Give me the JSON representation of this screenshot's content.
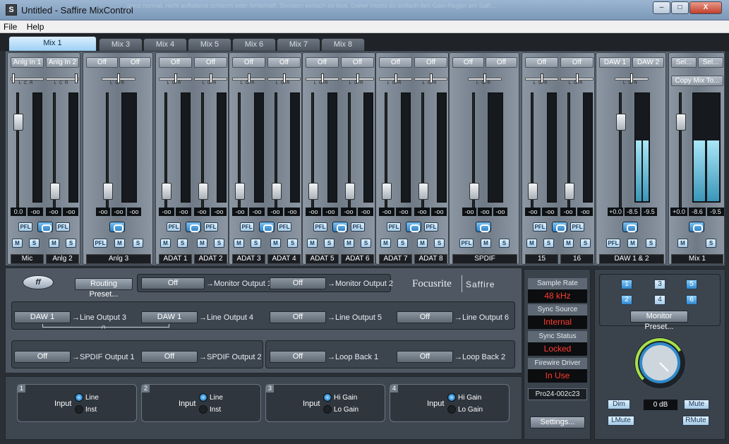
{
  "window": {
    "title": "Untitled - Saffire MixControl",
    "minimize": "–",
    "maximize": "□",
    "close": "X"
  },
  "menu": {
    "file": "File",
    "help": "Help"
  },
  "tabs": [
    "Mix 1",
    "Mix 3",
    "Mix 4",
    "Mix 5",
    "Mix 6",
    "Mix 7",
    "Mix 8"
  ],
  "strips": [
    {
      "left": "Anlg In 1",
      "right": "Anlg In 2",
      "read": [
        "0.0",
        "-oo",
        "-oo",
        "-oo"
      ],
      "name1": "Mic",
      "name2": "Anlg 2"
    },
    {
      "left": "Off",
      "right": "Off",
      "read": [
        "-oo",
        "-oo",
        "-oo"
      ],
      "name": "Anlg 3"
    },
    {
      "pair": [
        [
          "Off",
          "Off"
        ],
        [
          "Off",
          "Off"
        ]
      ],
      "reads": [
        "-oo",
        "-oo",
        "-oo",
        "-oo"
      ],
      "names": [
        "ADAT 1",
        "ADAT 2"
      ]
    },
    {
      "pair": [
        [
          "Off",
          "Off"
        ],
        [
          "Off",
          "Off"
        ]
      ],
      "reads": [
        "-oo",
        "-oo",
        "-oo",
        "-oo"
      ],
      "names": [
        "ADAT 3",
        "ADAT 4"
      ]
    },
    {
      "pair": [
        [
          "Off",
          "Off"
        ],
        [
          "Off",
          "Off"
        ]
      ],
      "reads": [
        "-oo",
        "-oo",
        "-oo",
        "-oo"
      ],
      "names": [
        "ADAT 5",
        "ADAT 6"
      ]
    },
    {
      "pair": [
        [
          "Off",
          "Off"
        ],
        [
          "Off",
          "Off"
        ]
      ],
      "reads": [
        "-oo",
        "-oo",
        "-oo",
        "-oo"
      ],
      "names": [
        "ADAT 7",
        "ADAT 8"
      ]
    },
    {
      "left": "Off",
      "right": "Off",
      "read": [
        "-oo",
        "-oo",
        "-oo"
      ],
      "name": "SPDIF"
    },
    {
      "pair": [
        [
          "Off",
          "Off"
        ],
        [
          "Off",
          "Off"
        ]
      ],
      "reads": [
        "-oo",
        "-oo",
        "-oo",
        "-oo"
      ],
      "names": [
        "15",
        "16"
      ]
    },
    {
      "left": "DAW 1",
      "right": "DAW 2",
      "read": [
        "+0.0",
        "-8.5",
        "-9.5"
      ],
      "name": "DAW 1 & 2"
    },
    {
      "left": "Sel...",
      "right": "Sel...",
      "copy": "Copy Mix To...",
      "read": [
        "+0.0",
        "-8.6",
        "-9.5"
      ],
      "name": "Mix 1"
    }
  ],
  "strip_buttons": {
    "pfl": "PFL",
    "m": "M",
    "s": "S"
  },
  "routing": {
    "logo_text": "ff",
    "routing_preset": "Routing Preset...",
    "monitor1_src": "Off",
    "monitor1_label": "→Monitor Output 1",
    "monitor2_src": "Off",
    "monitor2_label": "→Monitor Output 2",
    "brand1": "Focusrite",
    "brand2": "Saffire",
    "line3_src": "DAW 1",
    "line3_label": "→Line Output 3",
    "line4_src": "DAW 1",
    "line4_label": "→Line Output 4",
    "line5_src": "Off",
    "line5_label": "→Line Output 5",
    "line6_src": "Off",
    "line6_label": "→Line Output 6",
    "spdif1_src": "Off",
    "spdif1_label": "→SPDIF Output 1",
    "spdif2_src": "Off",
    "spdif2_label": "→SPDIF Output 2",
    "loop1_src": "Off",
    "loop1_label": "→Loop Back 1",
    "loop2_src": "Off",
    "loop2_label": "→Loop Back 2"
  },
  "inputs": [
    {
      "num": "1",
      "label": "Input",
      "opt1": "Line",
      "opt2": "Inst",
      "selected": 1
    },
    {
      "num": "2",
      "label": "Input",
      "opt1": "Line",
      "opt2": "Inst",
      "selected": 1
    },
    {
      "num": "3",
      "label": "Input",
      "opt1": "Hi Gain",
      "opt2": "Lo Gain",
      "selected": 1
    },
    {
      "num": "4",
      "label": "Input",
      "opt1": "Hi Gain",
      "opt2": "Lo Gain",
      "selected": 1
    }
  ],
  "status": {
    "sample_rate_label": "Sample Rate",
    "sample_rate": "48 kHz",
    "sync_source_label": "Sync Source",
    "sync_source": "Internal",
    "sync_status_label": "Sync Status",
    "sync_status": "Locked",
    "fw_label": "Firewire Driver",
    "fw_status": "In Use",
    "device": "Pro24-002c23",
    "settings": "Settings..."
  },
  "monitor": {
    "buttons": [
      "1",
      "2",
      "3",
      "4",
      "5",
      "6"
    ],
    "active": [
      "1",
      "2",
      "5",
      "6"
    ],
    "preset": "Monitor Preset...",
    "dim": "Dim",
    "level": "0 dB",
    "mute": "Mute",
    "lmute": "LMute",
    "rmute": "RMute",
    "knob_level": 0.72
  },
  "ghost_text": "ganz normal, nicht auffallend schlecht oder fehlerhaft, Sondern einfach so lese. Daher musst du einfach den Gain-Regler am Saff..."
}
